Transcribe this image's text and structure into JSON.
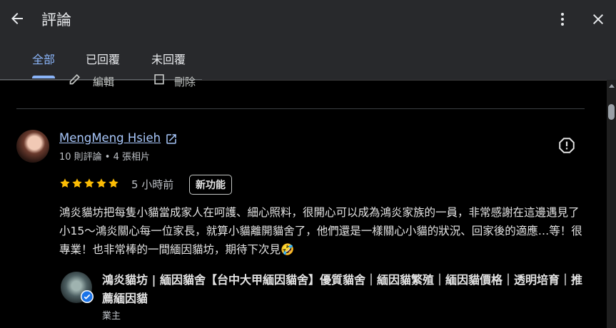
{
  "header": {
    "title": "評論",
    "back_icon": "arrow-left-icon",
    "more_icon": "more-vert-icon",
    "close_icon": "close-icon"
  },
  "tabs": [
    {
      "label": "全部",
      "active": true
    },
    {
      "label": "已回覆",
      "active": false
    },
    {
      "label": "未回覆",
      "active": false
    }
  ],
  "previous_actions": {
    "edit_label": "編輯",
    "delete_label": "刪除"
  },
  "review": {
    "reviewer_name": "MengMeng Hsieh",
    "reviewer_meta": "10 則評論 • 4 張相片",
    "rating": 5,
    "time": "5 小時前",
    "badge": "新功能",
    "text": "鴻炎貓坊把每隻小貓當成家人在呵護、細心照料，很開心可以成為鴻炎家族的一員，非常感謝在這邊遇見了小15～鴻炎關心每一位家長，就算小貓離開貓舍了，他們還是一樣關心小貓的狀況、回家後的適應…等！很專業！也非常棒的一間緬因貓坊，期待下次見🤣"
  },
  "owner_reply": {
    "name": "鴻炎貓坊 | 緬因貓舍【台中大甲緬因貓舍】優質貓舍｜緬因貓繁殖｜緬因貓價格｜透明培育｜推薦緬因貓",
    "role": "業主"
  },
  "colors": {
    "accent": "#8ab4f8",
    "link": "#a8c7fa",
    "star": "#fbbc04",
    "verified": "#1a73e8",
    "header_bg": "#28292c"
  }
}
